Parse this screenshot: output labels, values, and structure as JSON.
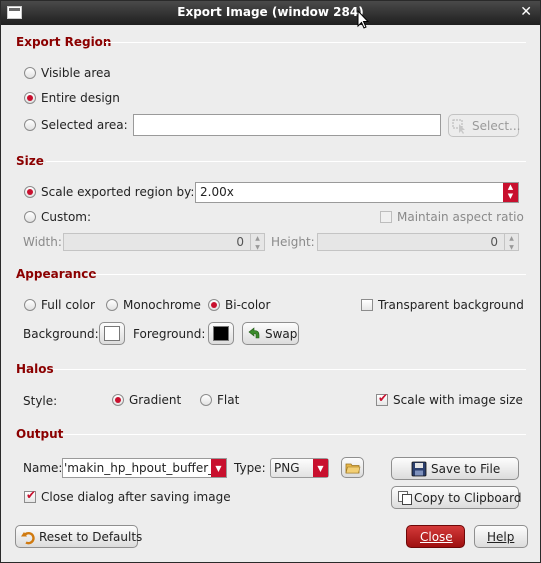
{
  "window": {
    "title": "Export Image (window 284)",
    "close_glyph": "✕"
  },
  "export_region": {
    "heading": "Export Region",
    "options": [
      "Visible area",
      "Entire design",
      "Selected area:"
    ],
    "selected": "Entire design",
    "selected_area_value": "",
    "select_button": "Select..."
  },
  "size": {
    "heading": "Size",
    "scale_label": "Scale exported region by:",
    "scale_value": "2.00x",
    "custom_label": "Custom:",
    "maintain_aspect": "Maintain aspect ratio",
    "width_label": "Width:",
    "width_value": "0",
    "height_label": "Height:",
    "height_value": "0",
    "selected": "scale"
  },
  "appearance": {
    "heading": "Appearance",
    "modes": [
      "Full color",
      "Monochrome",
      "Bi-color"
    ],
    "selected_mode": "Bi-color",
    "transparent_label": "Transparent background",
    "transparent_checked": false,
    "background_label": "Background:",
    "background_color": "#ffffff",
    "foreground_label": "Foreground:",
    "foreground_color": "#000000",
    "swap_label": "Swap"
  },
  "halos": {
    "heading": "Halos",
    "style_label": "Style:",
    "styles": [
      "Gradient",
      "Flat"
    ],
    "selected_style": "Gradient",
    "scale_label": "Scale with image size",
    "scale_checked": true
  },
  "output": {
    "heading": "Output",
    "name_label": "Name:",
    "name_value": "'makin_hp_hpout_buffer_v",
    "type_label": "Type:",
    "type_value": "PNG",
    "save_button": "Save to File",
    "close_after_label": "Close dialog after saving image",
    "close_after_checked": true,
    "copy_button": "Copy to Clipboard"
  },
  "footer": {
    "reset_button": "Reset to Defaults",
    "close_button": "Close",
    "help_button": "Help"
  },
  "colors": {
    "accent": "#c8102e",
    "section_heading": "#8b0000",
    "titlebar": "#2b2b2b"
  }
}
